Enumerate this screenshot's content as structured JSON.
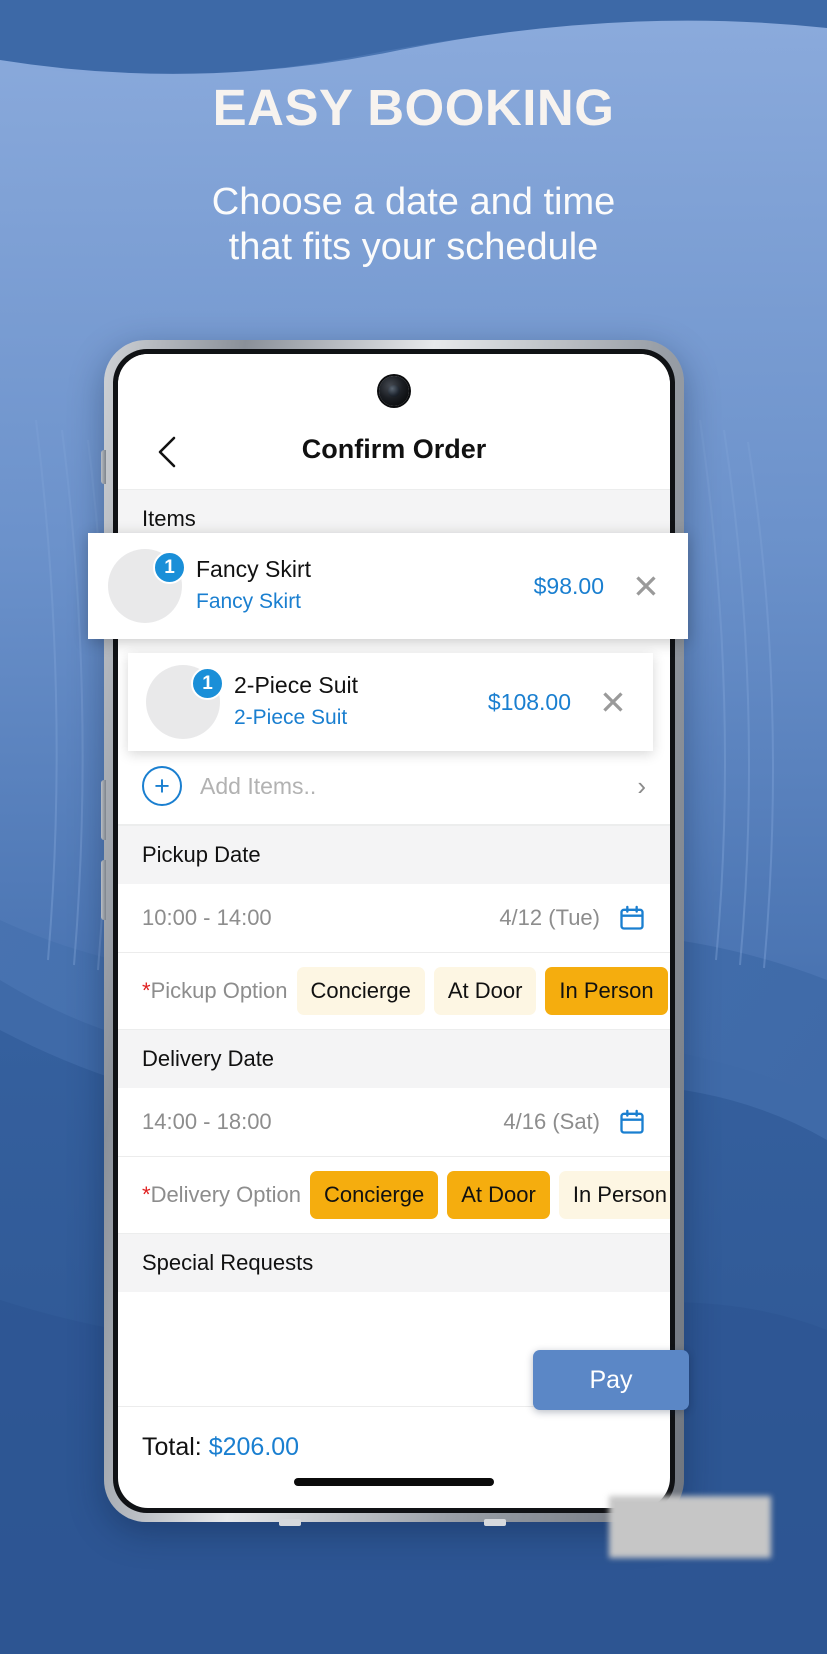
{
  "promo": {
    "headline": "EASY BOOKING",
    "subhead_line1": "Choose a date and time",
    "subhead_line2": "that fits your schedule"
  },
  "colors": {
    "background_blue": "#3e6aa8",
    "wave_light": "#86a8db",
    "accent_blue": "#1a7fd0",
    "chip_active": "#f5ad0e",
    "chip_inactive": "#fdf6e3",
    "pay_button": "#5b87c6",
    "required_star": "#e02020"
  },
  "app": {
    "back_icon": "chevron-left-icon",
    "title": "Confirm Order",
    "sections": {
      "items_label": "Items",
      "pickup_label": "Pickup Date",
      "delivery_label": "Delivery Date",
      "special_requests_label": "Special Requests"
    },
    "items": [
      {
        "name": "Fancy Skirt",
        "service": "Fancy Skirt",
        "price": "$98.00",
        "qty": "1",
        "remove_icon": "close-icon",
        "thumb": "skirt-photo"
      },
      {
        "name": "2-Piece Suit",
        "service": "2-Piece Suit",
        "price": "$108.00",
        "qty": "1",
        "remove_icon": "close-icon",
        "thumb": "suit-photo"
      }
    ],
    "add_items": {
      "plus_icon": "plus-circle-icon",
      "placeholder": "Add Items..",
      "chevron_icon": "chevron-right-icon"
    },
    "pickup": {
      "time_range": "10:00 - 14:00",
      "date": "4/12 (Tue)",
      "calendar_icon": "calendar-icon",
      "option_label": "Pickup Option",
      "required_marker": "*",
      "options": [
        {
          "label": "Concierge",
          "selected": false
        },
        {
          "label": "At Door",
          "selected": false
        },
        {
          "label": "In Person",
          "selected": true
        }
      ]
    },
    "delivery": {
      "time_range": "14:00 - 18:00",
      "date": "4/16 (Sat)",
      "calendar_icon": "calendar-icon",
      "option_label": "Delivery Option",
      "required_marker": "*",
      "options": [
        {
          "label": "Concierge",
          "selected": true
        },
        {
          "label": "At Door",
          "selected": true
        },
        {
          "label": "In Person",
          "selected": false
        }
      ]
    },
    "footer": {
      "total_label": "Total:",
      "total_value": "$206.00",
      "pay_label": "Pay"
    }
  }
}
